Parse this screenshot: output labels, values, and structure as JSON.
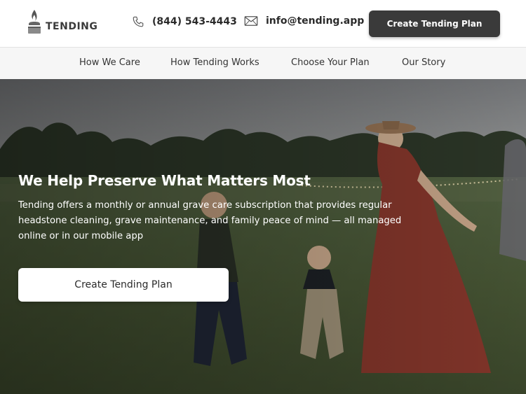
{
  "brand": {
    "name": "TENDING",
    "logo_icon": "candle-flame-icon"
  },
  "header": {
    "phone": {
      "icon": "phone-icon",
      "label": "(844) 543-4443"
    },
    "email": {
      "icon": "mail-icon",
      "label": "info@tending.app"
    },
    "cta_label": "Create Tending Plan"
  },
  "nav": {
    "items": [
      {
        "label": "How We Care"
      },
      {
        "label": "How Tending Works"
      },
      {
        "label": "Choose Your Plan"
      },
      {
        "label": "Our Story"
      }
    ]
  },
  "hero": {
    "title": "We Help Preserve What Matters Most",
    "description": "Tending offers a monthly or annual grave care subscription that provides regular headstone cleaning, grave maintenance, and family peace of mind — all managed online or in our mobile app",
    "cta_label": "Create Tending Plan",
    "image": "family-walking-in-meadow-photo"
  },
  "colors": {
    "dark_button": "#3a3a3a",
    "nav_background": "#f6f6f6",
    "hero_text": "#ffffff"
  }
}
